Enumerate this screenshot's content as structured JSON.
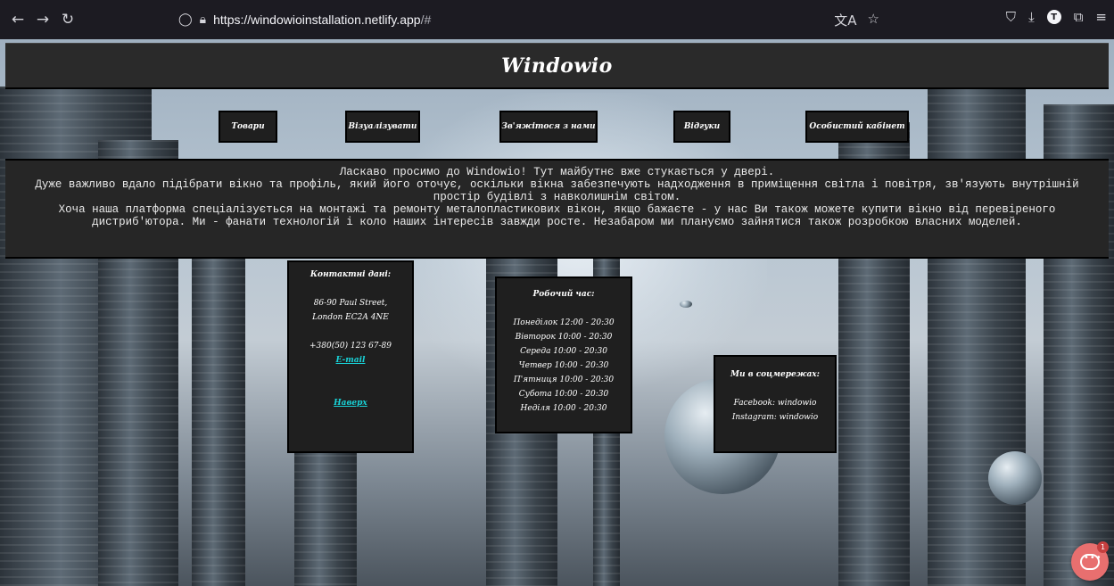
{
  "browser": {
    "url_host": "https://windowioinstallation.netlify.app",
    "url_path": "/#",
    "icons": [
      "back-arrow-icon",
      "forward-arrow-icon",
      "reload-icon",
      "shield-icon",
      "lock-icon",
      "translate-icon",
      "star-icon",
      "pocket-icon",
      "download-icon",
      "account-icon",
      "extensions-icon",
      "menu-icon"
    ]
  },
  "site": {
    "title": "Windowio"
  },
  "menu": {
    "items": [
      {
        "label": "Товари"
      },
      {
        "label": "Візуалізувати"
      },
      {
        "label": "Зв'яжітося з нами"
      },
      {
        "label": "Відгуки"
      },
      {
        "label": "Особистий кабінет"
      }
    ]
  },
  "intro": {
    "line1": "Ласкаво просимо до Windowio! Тут майбутнє вже стукається у двері.",
    "line2": "Дуже важливо вдало підібрати вікно та профіль, який його оточує, оскільки вікна забезпечують надходження в приміщення світла і повітря, зв'язують внутрішній простір будівлі з навколишнім світом.",
    "line3": "Хоча наша платформа спеціалізується на монтажі та ремонту металопластикових вікон, якщо бажаєте - у нас Ви також можете купити вікно від перевіреного дистриб'ютора. Ми - фанати технологій і коло наших інтересів завжди росте. Незабаром ми плануємо зайнятися також розробкою власних моделей."
  },
  "contacts": {
    "heading": "Контактні дані:",
    "address1": "86-90 Paul Street,",
    "address2": "London EC2A 4NE",
    "phone": "+380(50) 123 67-89",
    "email_link": "E-mail",
    "top_link": "Наверх"
  },
  "hours": {
    "heading": "Робочий час:",
    "days": [
      "Понеділок 12:00 - 20:30",
      "Вівторок 10:00 - 20:30",
      "Середа 10:00 - 20:30",
      "Четвер 10:00 - 20:30",
      "П'ятниця 10:00 - 20:30",
      "Субота 10:00 - 20:30",
      "Неділя 10:00 - 20:30"
    ]
  },
  "social": {
    "heading": "Ми в соцмережах:",
    "facebook": "Facebook: windowio",
    "instagram": "Instagram: windowio"
  },
  "chat": {
    "badge": "1",
    "color": "#e86f6f"
  }
}
